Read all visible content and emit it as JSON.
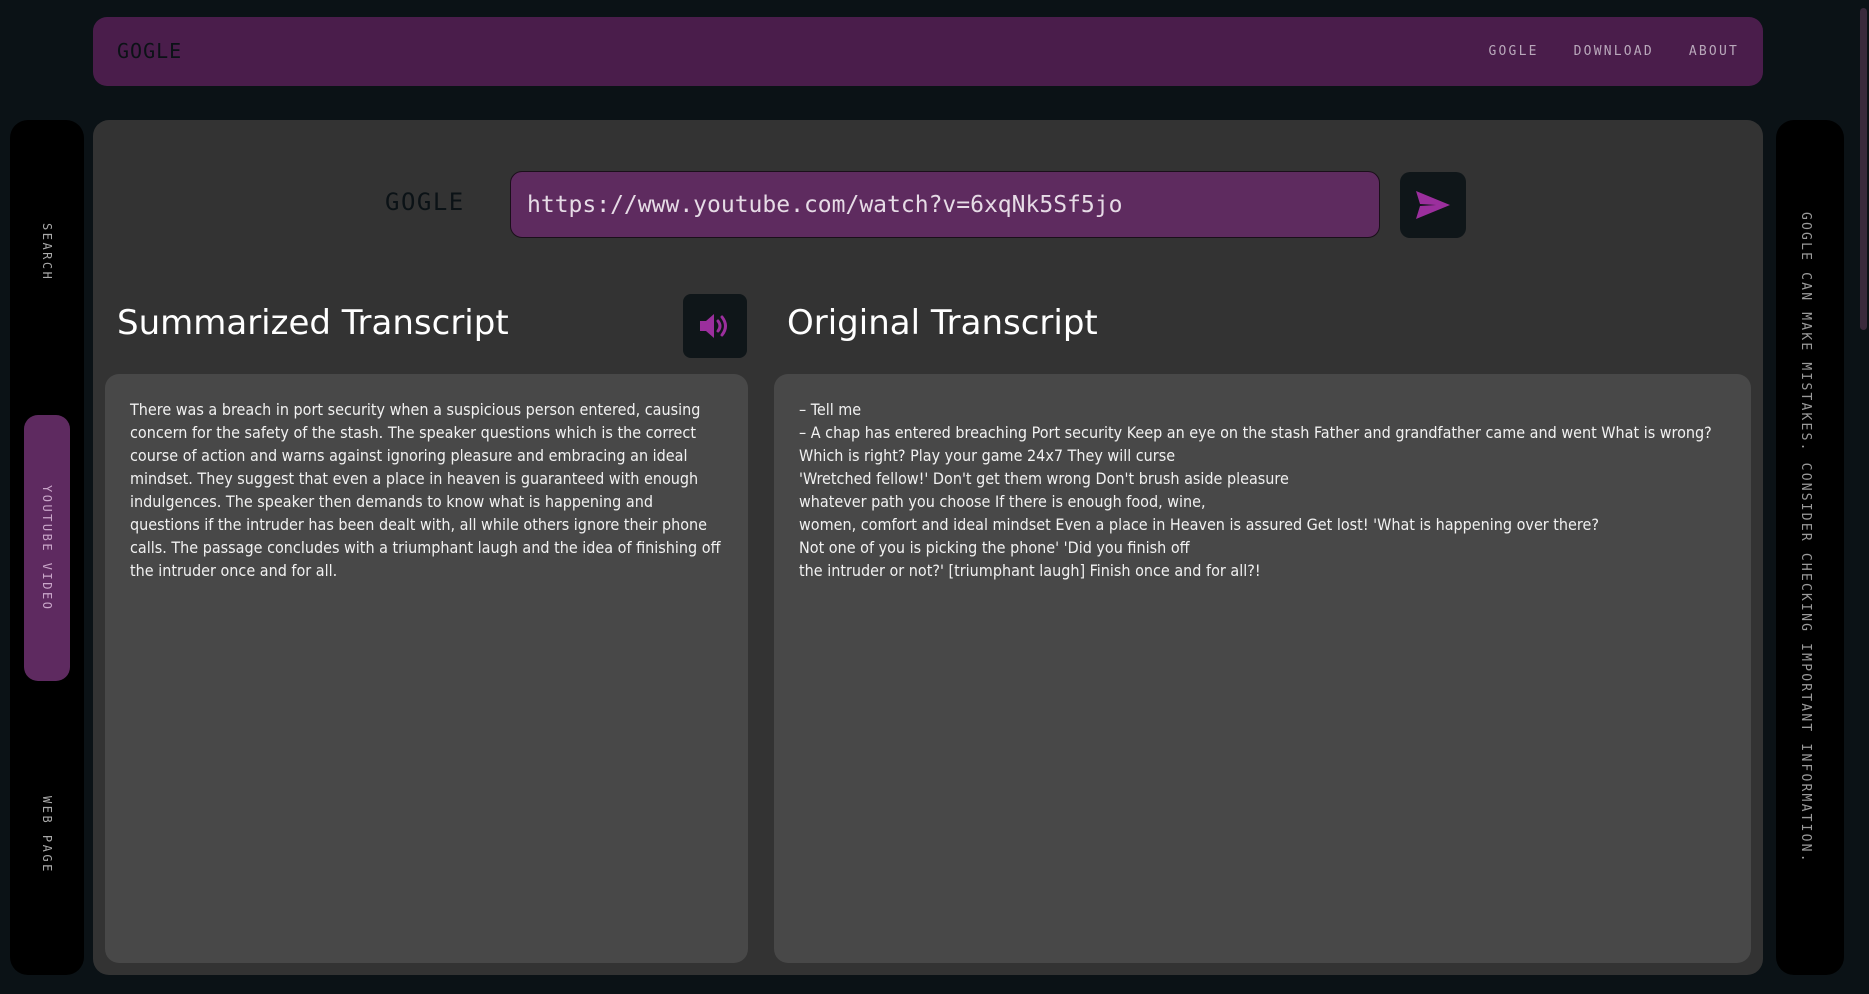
{
  "header": {
    "brand": "GOGLE",
    "nav": [
      "GOGLE",
      "DOWNLOAD",
      "ABOUT"
    ]
  },
  "left_nav": {
    "items": [
      {
        "label": "SEARCH",
        "active": false
      },
      {
        "label": "YOUTUBE VIDEO",
        "active": true
      },
      {
        "label": "WEB PAGE",
        "active": false
      }
    ]
  },
  "disclaimer": "GOGLE CAN MAKE MISTAKES. CONSIDER CHECKING IMPORTANT INFORMATION.",
  "search": {
    "logo": "GOGLE",
    "url_value": "https://www.youtube.com/watch?v=6xqNk5Sf5jo",
    "send_icon": "send-icon"
  },
  "summary": {
    "title": "Summarized Transcript",
    "speaker_icon": "speaker-icon",
    "text": "There was a breach in port security when a suspicious person entered, causing concern for the safety of the stash. The speaker questions which is the correct course of action and warns against ignoring pleasure and embracing an ideal mindset. They suggest that even a place in heaven is guaranteed with enough indulgences. The speaker then demands to know what is happening and questions if the intruder has been dealt with, all while others ignore their phone calls. The passage concludes with a triumphant laugh and the idea of finishing off the intruder once and for all."
  },
  "original": {
    "title": "Original Transcript",
    "text": "– Tell me\n– A chap has entered breaching Port security Keep an eye on the stash Father and grandfather came and went What is wrong?\nWhich is right? Play your game 24x7 They will curse\n'Wretched fellow!' Don't get them wrong Don't brush aside pleasure\nwhatever path you choose If there is enough food, wine,\nwomen, comfort and ideal mindset Even a place in Heaven is assured Get lost! 'What is happening over there?\nNot one of you is picking the phone' 'Did you finish off\nthe intruder or not?' [triumphant laugh] Finish once and for all?!"
  },
  "colors": {
    "background": "#0b1216",
    "accent": "#4a1d4b",
    "input": "#5e2b5f",
    "icon": "#9b2f9d",
    "panel": "#484848",
    "main": "#333333"
  }
}
